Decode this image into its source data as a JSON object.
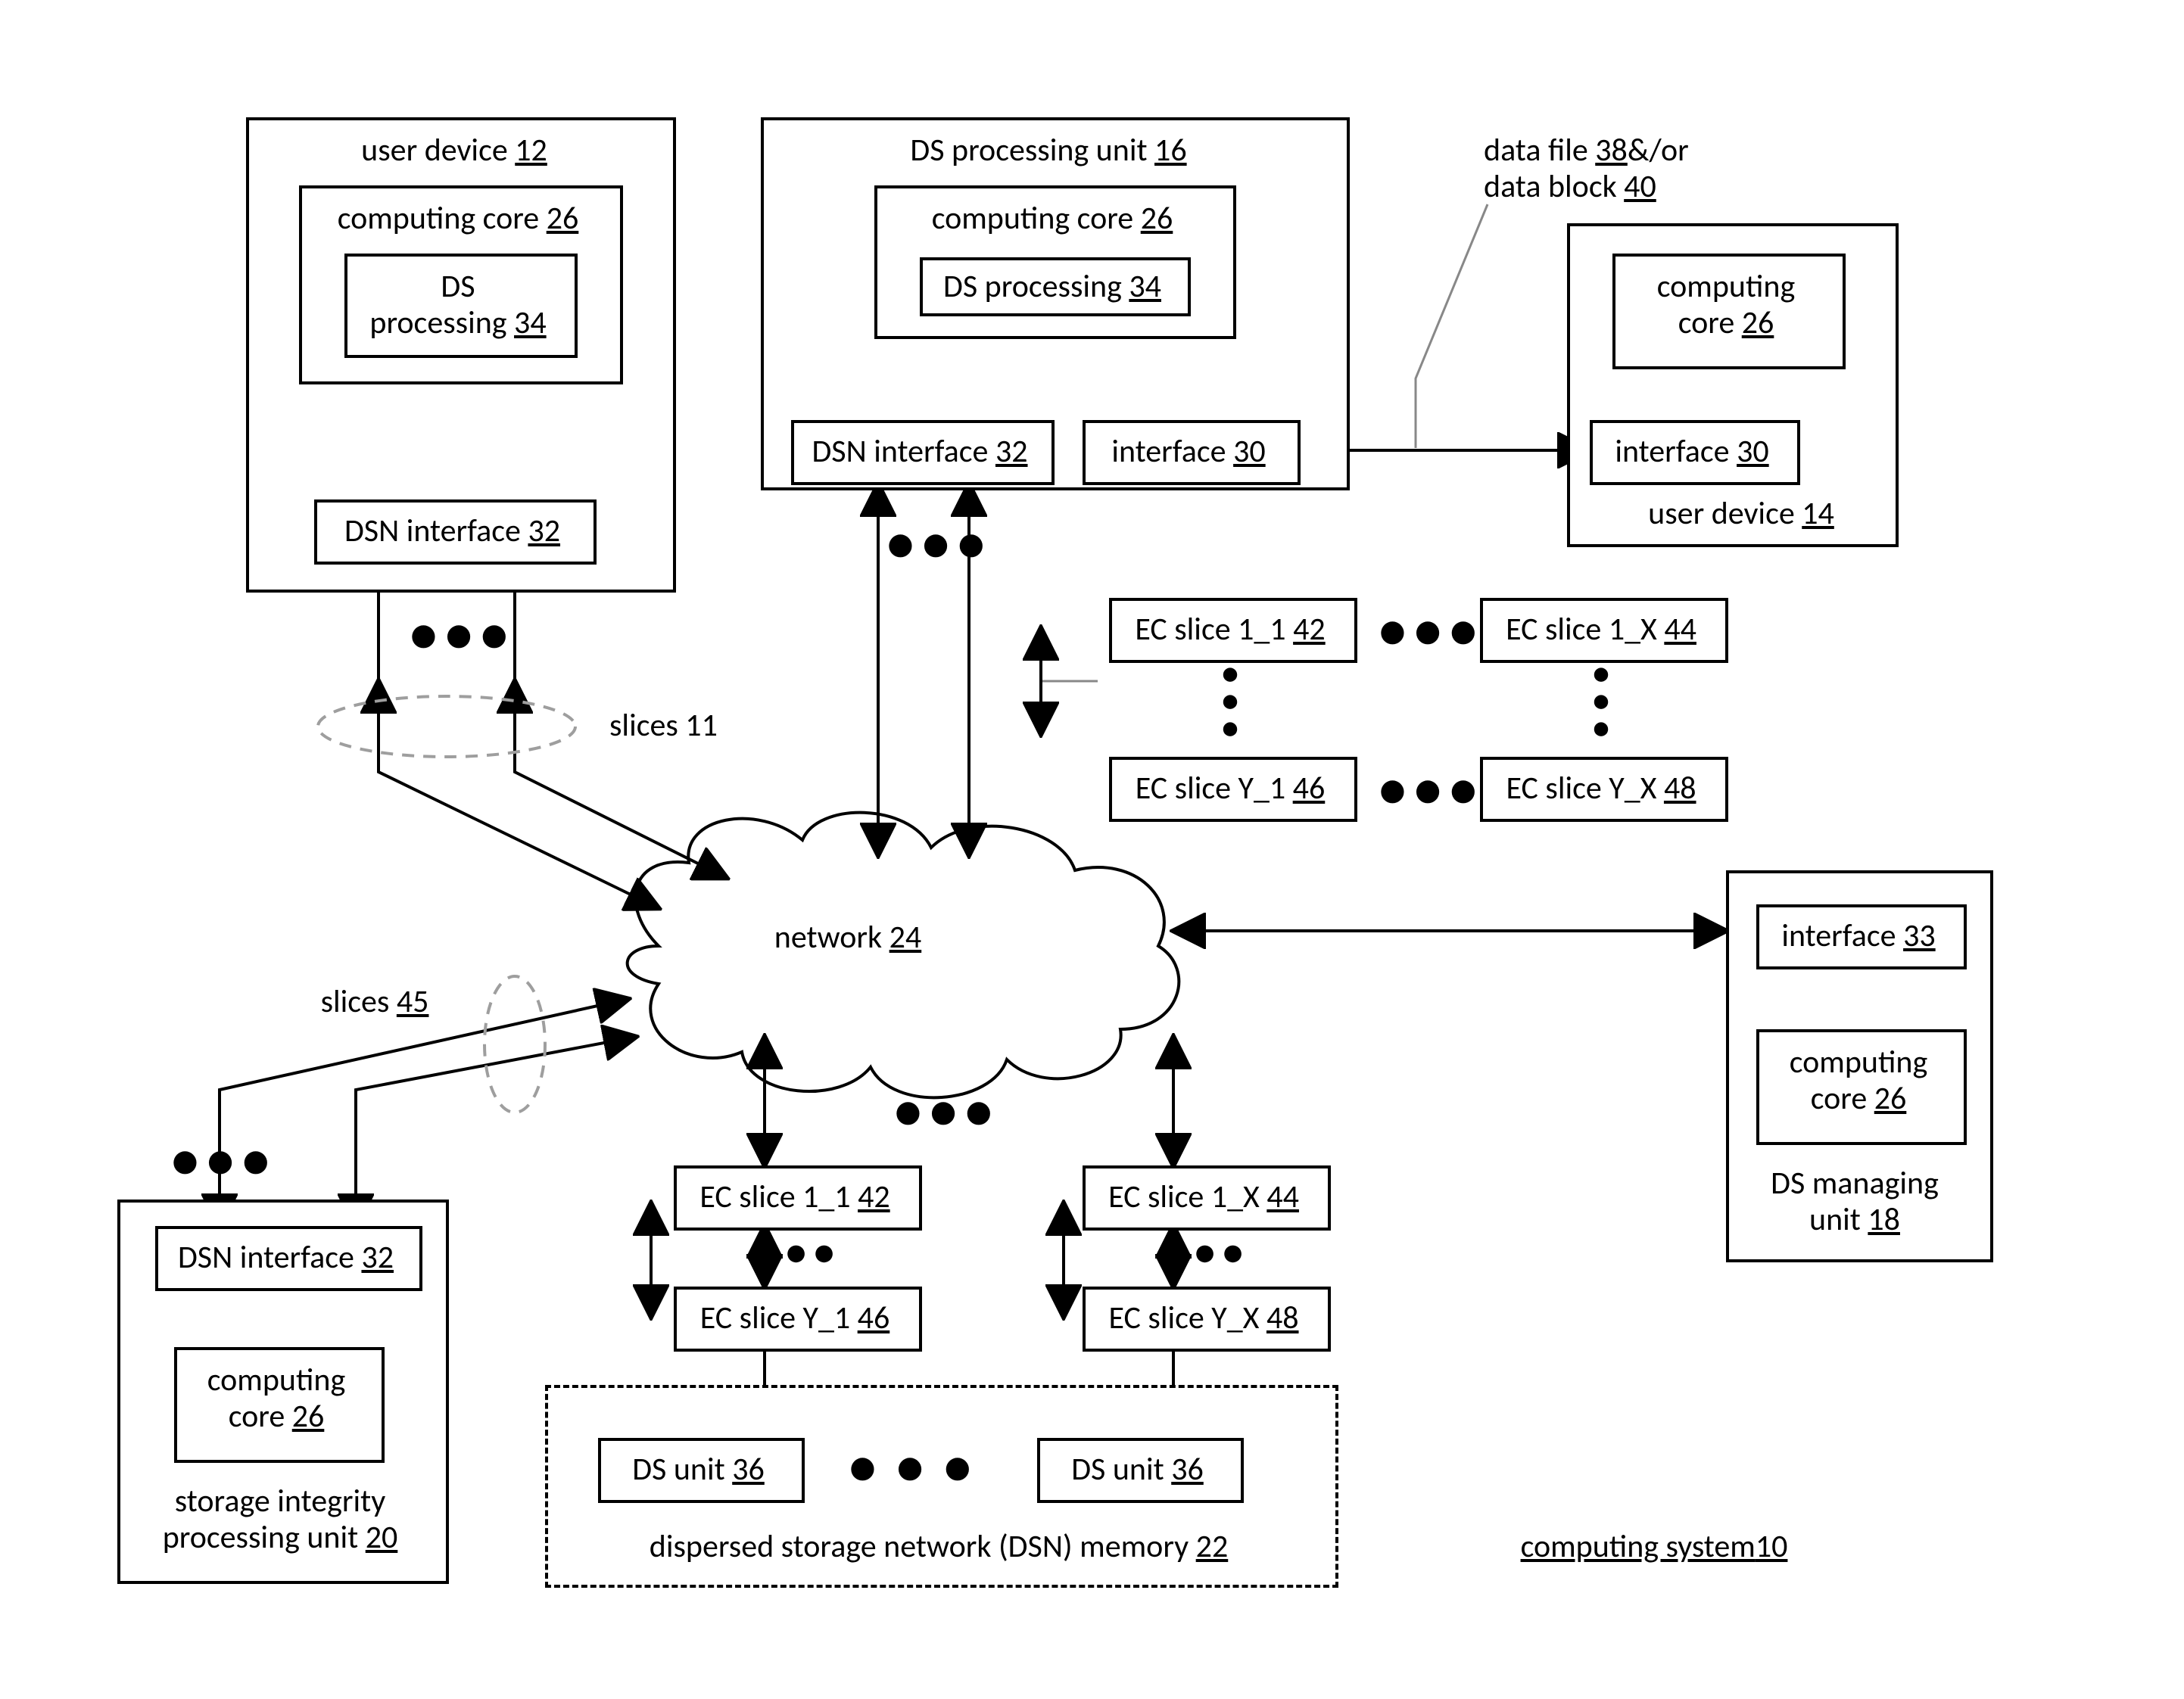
{
  "system_label": {
    "text": "computing system",
    "ref": "10"
  },
  "user_device_12": {
    "title": "user device",
    "ref": "12"
  },
  "user_device_14": {
    "title": "user device",
    "ref": "14"
  },
  "ds_processing_unit": {
    "title": "DS processing unit",
    "ref": "16"
  },
  "ds_managing_unit": {
    "title": "DS managing",
    "title2": "unit",
    "ref": "18"
  },
  "storage_integrity_unit": {
    "title": "storage integrity",
    "title2": "processing unit",
    "ref": "20"
  },
  "dsn_memory": {
    "title": "dispersed storage network (DSN) memory",
    "ref": "22"
  },
  "network": {
    "title": "network",
    "ref": "24"
  },
  "computing_core": {
    "title": "computing core",
    "ref": "26"
  },
  "computing_core_ml": {
    "title": "computing",
    "title2": "core",
    "ref": "26"
  },
  "ds_processing_34": {
    "title": "DS processing",
    "ref": "34"
  },
  "ds_processing_34_ml": {
    "title": "DS",
    "title2": "processing",
    "ref": "34"
  },
  "dsn_interface": {
    "title": "DSN interface",
    "ref": "32"
  },
  "interface_30": {
    "title": "interface",
    "ref": "30"
  },
  "interface_33": {
    "title": "interface",
    "ref": "33"
  },
  "ds_unit": {
    "title": "DS unit",
    "ref": "36"
  },
  "data_file": {
    "title": "data file",
    "ref": "38",
    "amp": "&/or"
  },
  "data_block": {
    "title": "data block",
    "ref": "40"
  },
  "slices_11": {
    "title": "slices 11"
  },
  "slices_45": {
    "title": "slices",
    "ref": "45"
  },
  "ec_slice_1_1": {
    "title": "EC slice 1_1",
    "ref": "42"
  },
  "ec_slice_1_X": {
    "title": "EC slice 1_X",
    "ref": "44"
  },
  "ec_slice_Y_1": {
    "title": "EC slice Y_1",
    "ref": "46"
  },
  "ec_slice_Y_X": {
    "title": "EC slice Y_X",
    "ref": "48"
  }
}
